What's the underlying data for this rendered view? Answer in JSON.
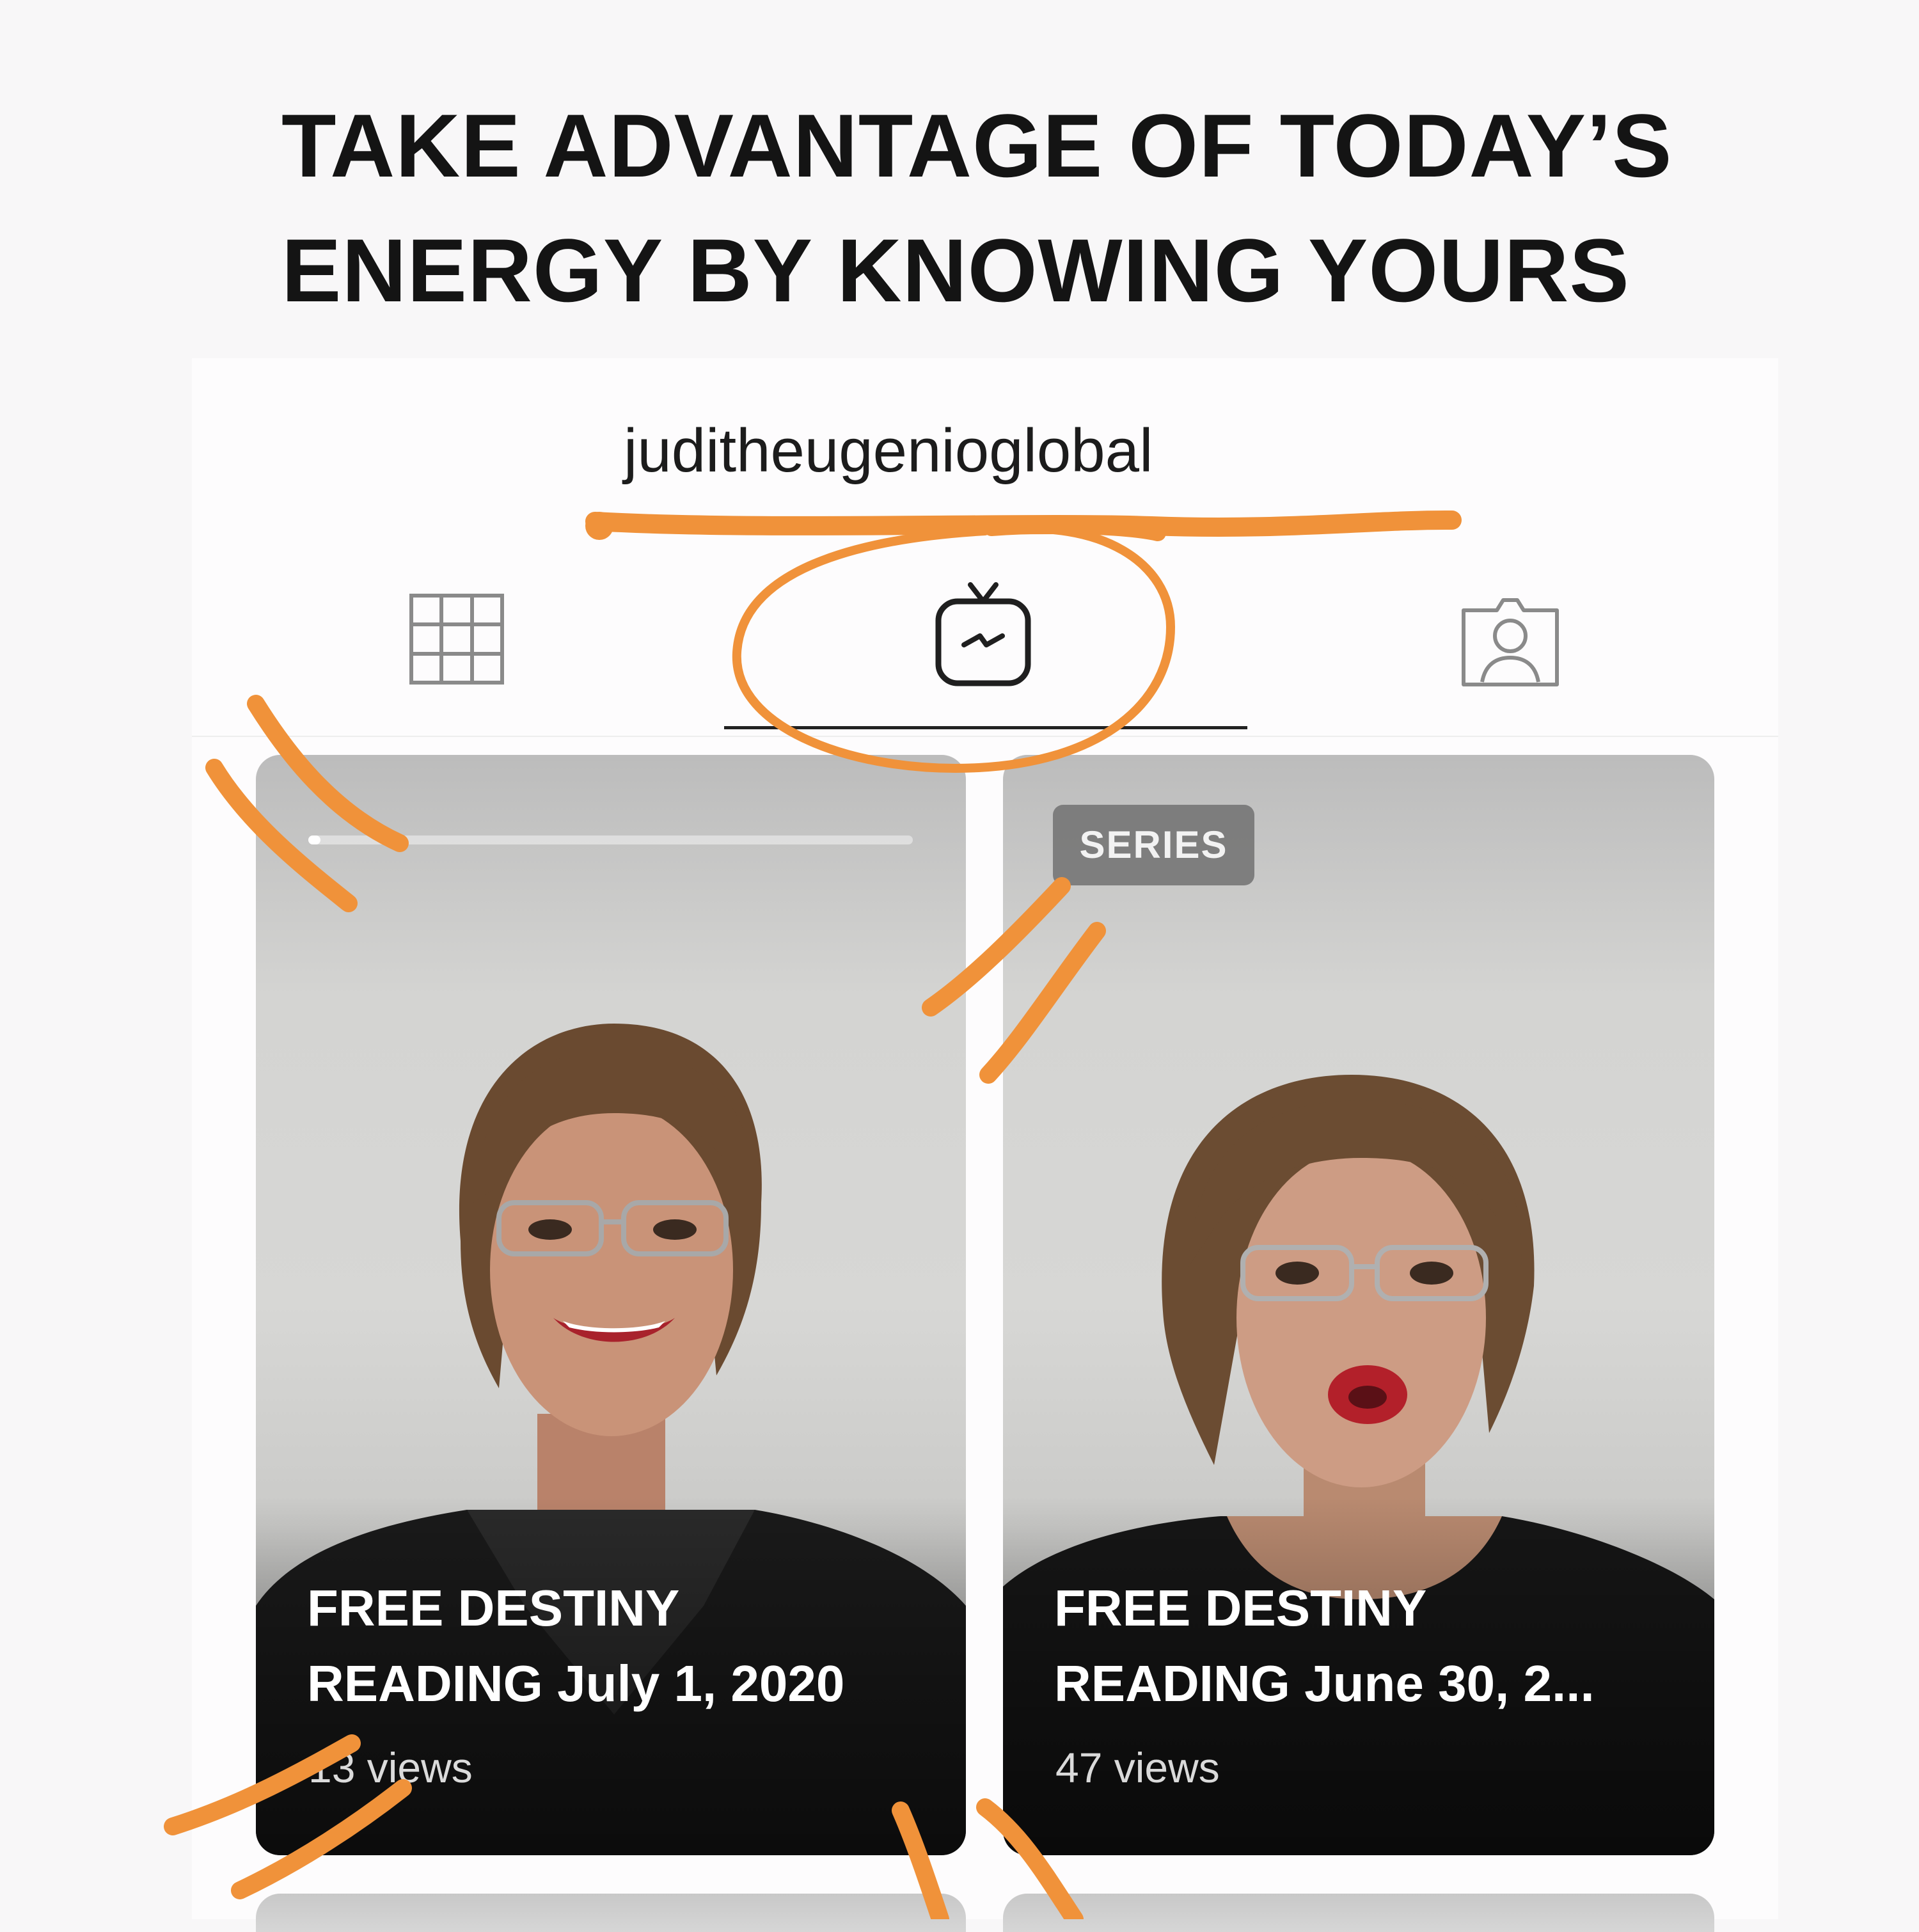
{
  "headline": {
    "line1": "TAKE ADVANTAGE OF TODAY’S",
    "line2": "ENERGY BY KNOWING YOURS"
  },
  "profile": {
    "username": "juditheugenioglobal"
  },
  "tabs": [
    {
      "icon": "grid-icon",
      "selected": false
    },
    {
      "icon": "igtv-icon",
      "selected": true
    },
    {
      "icon": "tagged-icon",
      "selected": false
    }
  ],
  "videos": [
    {
      "title_line1": "FREE DESTINY",
      "title_line2": "READING July 1, 2020",
      "views": "13 views",
      "progress": 0.02,
      "badge": ""
    },
    {
      "badge": "SERIES",
      "title_line1": "FREE DESTINY",
      "title_line2": "READING June 30, 2...",
      "views": "47 views"
    }
  ],
  "colors": {
    "annotation": "#f0923a",
    "background": "#f8f7f8",
    "text": "#141414"
  }
}
